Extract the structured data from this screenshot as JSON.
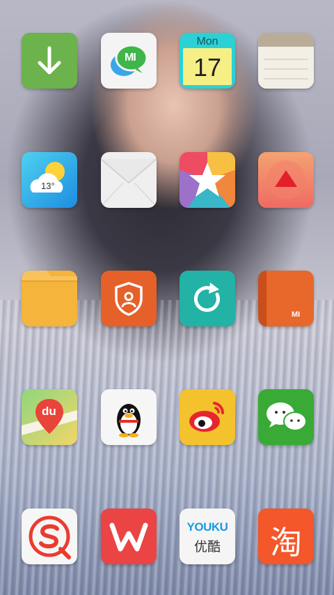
{
  "home_screen": {
    "calendar": {
      "weekday": "Mon",
      "day": "17"
    },
    "weather": {
      "temperature": "13°"
    },
    "youku": {
      "brand": "YOUKU",
      "brand_cn": "优酷"
    },
    "taobao": {
      "glyph": "淘"
    },
    "baidu_map": {
      "brand": "du"
    },
    "mi_brand": "MI",
    "apps": [
      {
        "id": "downloads",
        "icon": "download-arrow-icon",
        "color": "#6ab04c"
      },
      {
        "id": "mi-talk",
        "icon": "mi-chat-bubbles-icon",
        "color": "#f2f2f2"
      },
      {
        "id": "calendar",
        "icon": "calendar-icon",
        "color": "#2bd1d5"
      },
      {
        "id": "notes",
        "icon": "notepad-icon",
        "color": "#f3efe7"
      },
      {
        "id": "weather",
        "icon": "sun-cloud-icon",
        "color": "#2ca8e8"
      },
      {
        "id": "email",
        "icon": "envelope-icon",
        "color": "#efefef"
      },
      {
        "id": "gallery",
        "icon": "star-icon",
        "color": "#f0a53a"
      },
      {
        "id": "updater",
        "icon": "up-triangle-icon",
        "color": "#f0866a"
      },
      {
        "id": "file-manager",
        "icon": "folder-icon",
        "color": "#f4b43c"
      },
      {
        "id": "security",
        "icon": "shield-user-icon",
        "color": "#e8612a"
      },
      {
        "id": "backup",
        "icon": "refresh-arrow-icon",
        "color": "#23b1a6"
      },
      {
        "id": "mi-store",
        "icon": "mi-box-icon",
        "color": "#e06224"
      },
      {
        "id": "baidu-map",
        "icon": "map-pin-icon",
        "color": "#7fcf6f"
      },
      {
        "id": "qq",
        "icon": "penguin-icon",
        "color": "#f5f5f5"
      },
      {
        "id": "weibo",
        "icon": "weibo-eye-icon",
        "color": "#f4c02c"
      },
      {
        "id": "wechat",
        "icon": "wechat-bubbles-icon",
        "color": "#3aaa35"
      },
      {
        "id": "sogou-input",
        "icon": "sogou-s-icon",
        "color": "#f5f5f5"
      },
      {
        "id": "wps-office",
        "icon": "wps-w-icon",
        "color": "#e94343"
      },
      {
        "id": "youku",
        "icon": "youku-logo-icon",
        "color": "#f5f5f5"
      },
      {
        "id": "taobao",
        "icon": "taobao-glyph-icon",
        "color": "#f3572a"
      }
    ]
  }
}
